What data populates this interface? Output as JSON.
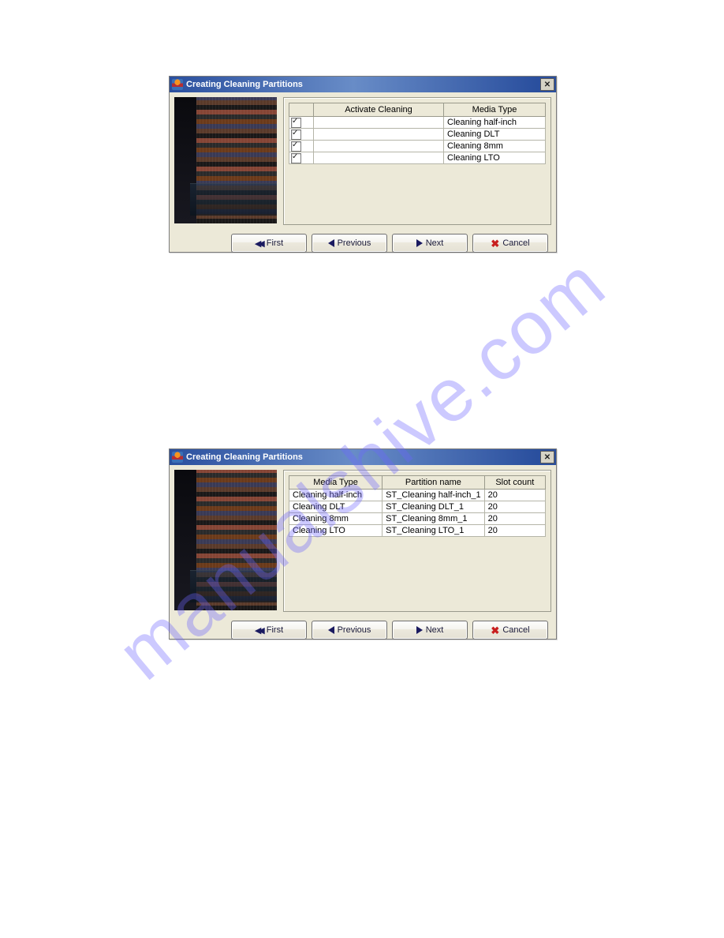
{
  "watermark": "manualshive.com",
  "dialogs": {
    "d1": {
      "title": "Creating Cleaning Partitions",
      "columns": {
        "c1": "Activate Cleaning",
        "c2": "Media Type"
      },
      "rows": [
        {
          "checked": true,
          "media": "Cleaning half-inch"
        },
        {
          "checked": true,
          "media": "Cleaning DLT"
        },
        {
          "checked": true,
          "media": "Cleaning 8mm"
        },
        {
          "checked": true,
          "media": "Cleaning LTO"
        }
      ]
    },
    "d2": {
      "title": "Creating Cleaning Partitions",
      "columns": {
        "c1": "Media Type",
        "c2": "Partition name",
        "c3": "Slot count"
      },
      "rows": [
        {
          "media": "Cleaning half-inch",
          "partition": "ST_Cleaning half-inch_1",
          "slots": "20"
        },
        {
          "media": "Cleaning DLT",
          "partition": "ST_Cleaning DLT_1",
          "slots": "20"
        },
        {
          "media": "Cleaning 8mm",
          "partition": "ST_Cleaning 8mm_1",
          "slots": "20"
        },
        {
          "media": "Cleaning LTO",
          "partition": "ST_Cleaning LTO_1",
          "slots": "20"
        }
      ]
    }
  },
  "buttons": {
    "first": "First",
    "previous": "Previous",
    "next": "Next",
    "cancel": "Cancel"
  }
}
